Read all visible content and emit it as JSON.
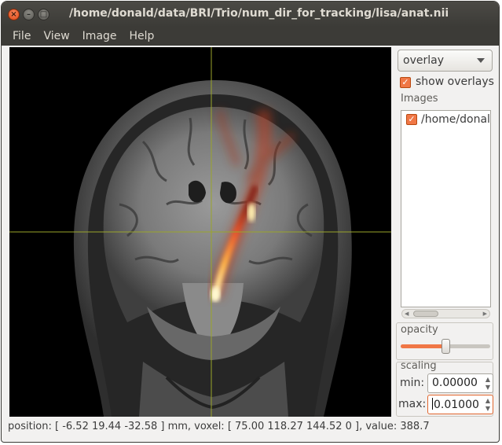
{
  "window": {
    "title": "/home/donald/data/BRI/Trio/num_dir_for_tracking/lisa/anat.nii",
    "close_glyph": "×",
    "minimize_glyph": "–",
    "maximize_glyph": "□"
  },
  "menu": {
    "items": [
      "File",
      "View",
      "Image",
      "Help"
    ]
  },
  "panel": {
    "mode_dropdown": "overlay",
    "show_overlays_label": "show overlays",
    "show_overlays_checked": true,
    "images_label": "Images",
    "images": [
      {
        "name": "/home/donald",
        "checked": true
      }
    ],
    "opacity_label": "opacity",
    "opacity_value": 0.5,
    "scaling_label": "scaling",
    "min_label": "min:",
    "min_value": "0.00000",
    "max_label": "max:",
    "max_value": "0.01000"
  },
  "status": {
    "text": "position: [ -6.52 19.44 -32.58 ] mm, voxel: [ 75.00 118.27 144.52 0 ], value: 388.7"
  },
  "colors": {
    "accent": "#f07746",
    "crosshair": "#9aa52a",
    "titlebar": "#3c3b37"
  },
  "icons": {
    "close": "close-icon",
    "minimize": "minimize-icon",
    "maximize": "maximize-icon",
    "dropdown": "chevron-down-icon",
    "checkbox": "checkmark-icon"
  }
}
